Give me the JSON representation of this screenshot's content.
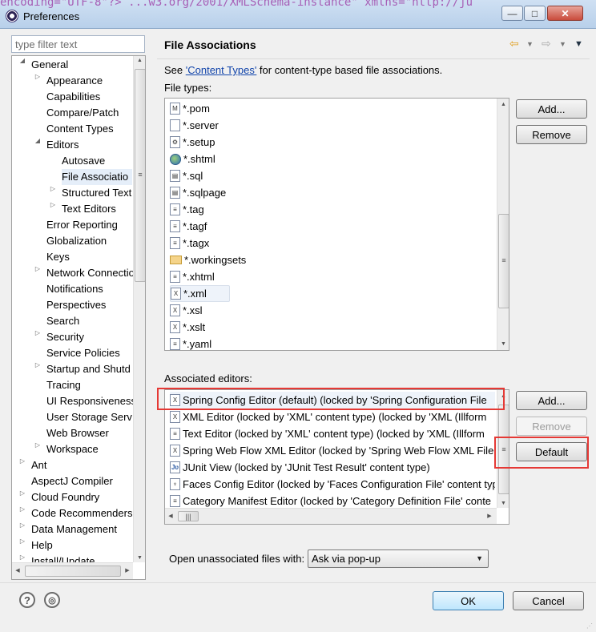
{
  "window": {
    "title": "Preferences",
    "bg_code": "encoding=\"UTF-8\"?>  ...w3.org/2001/XMLSchema-instance\" xmlns=\"http://ju",
    "minimize": "—",
    "maximize": "□",
    "close": "✕"
  },
  "filter": {
    "placeholder": "type filter text"
  },
  "tree": {
    "items": [
      {
        "label": "General",
        "level": 1,
        "toggle": "expanded"
      },
      {
        "label": "Appearance",
        "level": 2,
        "toggle": "collapsed"
      },
      {
        "label": "Capabilities",
        "level": 2,
        "toggle": "none"
      },
      {
        "label": "Compare/Patch",
        "level": 2,
        "toggle": "none"
      },
      {
        "label": "Content Types",
        "level": 2,
        "toggle": "none"
      },
      {
        "label": "Editors",
        "level": 2,
        "toggle": "expanded"
      },
      {
        "label": "Autosave",
        "level": 3,
        "toggle": "none"
      },
      {
        "label": "File Associatio",
        "level": 3,
        "toggle": "none",
        "selected": true
      },
      {
        "label": "Structured Text",
        "level": 3,
        "toggle": "collapsed"
      },
      {
        "label": "Text Editors",
        "level": 3,
        "toggle": "collapsed"
      },
      {
        "label": "Error Reporting",
        "level": 2,
        "toggle": "none"
      },
      {
        "label": "Globalization",
        "level": 2,
        "toggle": "none"
      },
      {
        "label": "Keys",
        "level": 2,
        "toggle": "none"
      },
      {
        "label": "Network Connectio",
        "level": 2,
        "toggle": "collapsed"
      },
      {
        "label": "Notifications",
        "level": 2,
        "toggle": "none"
      },
      {
        "label": "Perspectives",
        "level": 2,
        "toggle": "none"
      },
      {
        "label": "Search",
        "level": 2,
        "toggle": "none"
      },
      {
        "label": "Security",
        "level": 2,
        "toggle": "collapsed"
      },
      {
        "label": "Service Policies",
        "level": 2,
        "toggle": "none"
      },
      {
        "label": "Startup and Shutd",
        "level": 2,
        "toggle": "collapsed"
      },
      {
        "label": "Tracing",
        "level": 2,
        "toggle": "none"
      },
      {
        "label": "UI Responsiveness",
        "level": 2,
        "toggle": "none"
      },
      {
        "label": "User Storage Serv",
        "level": 2,
        "toggle": "none"
      },
      {
        "label": "Web Browser",
        "level": 2,
        "toggle": "none"
      },
      {
        "label": "Workspace",
        "level": 2,
        "toggle": "collapsed"
      },
      {
        "label": "Ant",
        "level": 1,
        "toggle": "collapsed"
      },
      {
        "label": "AspectJ Compiler",
        "level": 1,
        "toggle": "none"
      },
      {
        "label": "Cloud Foundry",
        "level": 1,
        "toggle": "collapsed"
      },
      {
        "label": "Code Recommenders",
        "level": 1,
        "toggle": "collapsed"
      },
      {
        "label": "Data Management",
        "level": 1,
        "toggle": "collapsed"
      },
      {
        "label": "Help",
        "level": 1,
        "toggle": "collapsed"
      },
      {
        "label": "Install/Update",
        "level": 1,
        "toggle": "collapsed"
      }
    ]
  },
  "page": {
    "title": "File Associations",
    "see_prefix": "See ",
    "see_link": "'Content Types'",
    "see_suffix": " for content-type based file associations.",
    "file_types_label": "File types:",
    "associated_label": "Associated editors:",
    "open_unassociated_label": "Open unassociated files with:",
    "open_unassociated_value": "Ask via pop-up"
  },
  "file_types": [
    {
      "label": "*.pom",
      "icon": "maven-file-icon",
      "glyph": "M"
    },
    {
      "label": "*.server",
      "icon": "server-file-icon",
      "glyph": ""
    },
    {
      "label": "*.setup",
      "icon": "setup-file-icon",
      "glyph": "⚙"
    },
    {
      "label": "*.shtml",
      "icon": "globe-icon",
      "glyph": ""
    },
    {
      "label": "*.sql",
      "icon": "sql-file-icon",
      "glyph": "▤"
    },
    {
      "label": "*.sqlpage",
      "icon": "sql-file-icon",
      "glyph": "▤"
    },
    {
      "label": "*.tag",
      "icon": "text-file-icon",
      "glyph": "≡"
    },
    {
      "label": "*.tagf",
      "icon": "text-file-icon",
      "glyph": "≡"
    },
    {
      "label": "*.tagx",
      "icon": "text-file-icon",
      "glyph": "≡"
    },
    {
      "label": "*.workingsets",
      "icon": "folder-icon",
      "glyph": ""
    },
    {
      "label": "*.xhtml",
      "icon": "xhtml-file-icon",
      "glyph": "≡"
    },
    {
      "label": "*.xml",
      "icon": "xml-file-icon",
      "glyph": "X",
      "selected": true
    },
    {
      "label": "*.xsl",
      "icon": "xsl-file-icon",
      "glyph": "X"
    },
    {
      "label": "*.xslt",
      "icon": "xsl-file-icon",
      "glyph": "X"
    },
    {
      "label": "*.yaml",
      "icon": "text-file-icon",
      "glyph": "≡"
    }
  ],
  "editors": [
    {
      "label": "Spring Config Editor (default) (locked by 'Spring Configuration File",
      "icon": "spring-xml-icon",
      "glyph": "X",
      "selected": true
    },
    {
      "label": "XML Editor (locked by 'XML' content type) (locked by 'XML (Illform",
      "icon": "xml-editor-icon",
      "glyph": "X"
    },
    {
      "label": "Text Editor (locked by 'XML' content type) (locked by 'XML (Illform",
      "icon": "text-editor-icon",
      "glyph": "≡"
    },
    {
      "label": "Spring Web Flow XML Editor (locked by 'Spring Web Flow XML File",
      "icon": "webflow-xml-icon",
      "glyph": "X"
    },
    {
      "label": "JUnit View (locked by 'JUnit Test Result' content type)",
      "icon": "junit-icon",
      "glyph": "Jʋ"
    },
    {
      "label": "Faces Config Editor (locked by 'Faces Configuration File' content typ",
      "icon": "faces-config-icon",
      "glyph": "♆"
    },
    {
      "label": "Category Manifest Editor (locked by 'Category Definition File' conte",
      "icon": "category-manifest-icon",
      "glyph": "≡"
    }
  ],
  "buttons": {
    "add1": "Add...",
    "remove1": "Remove",
    "add2": "Add...",
    "remove2": "Remove",
    "default": "Default",
    "ok": "OK",
    "cancel": "Cancel"
  },
  "bottom": {
    "help": "?",
    "import": "◎"
  },
  "colors": {
    "highlight": "#e53935",
    "link": "#1144aa"
  }
}
